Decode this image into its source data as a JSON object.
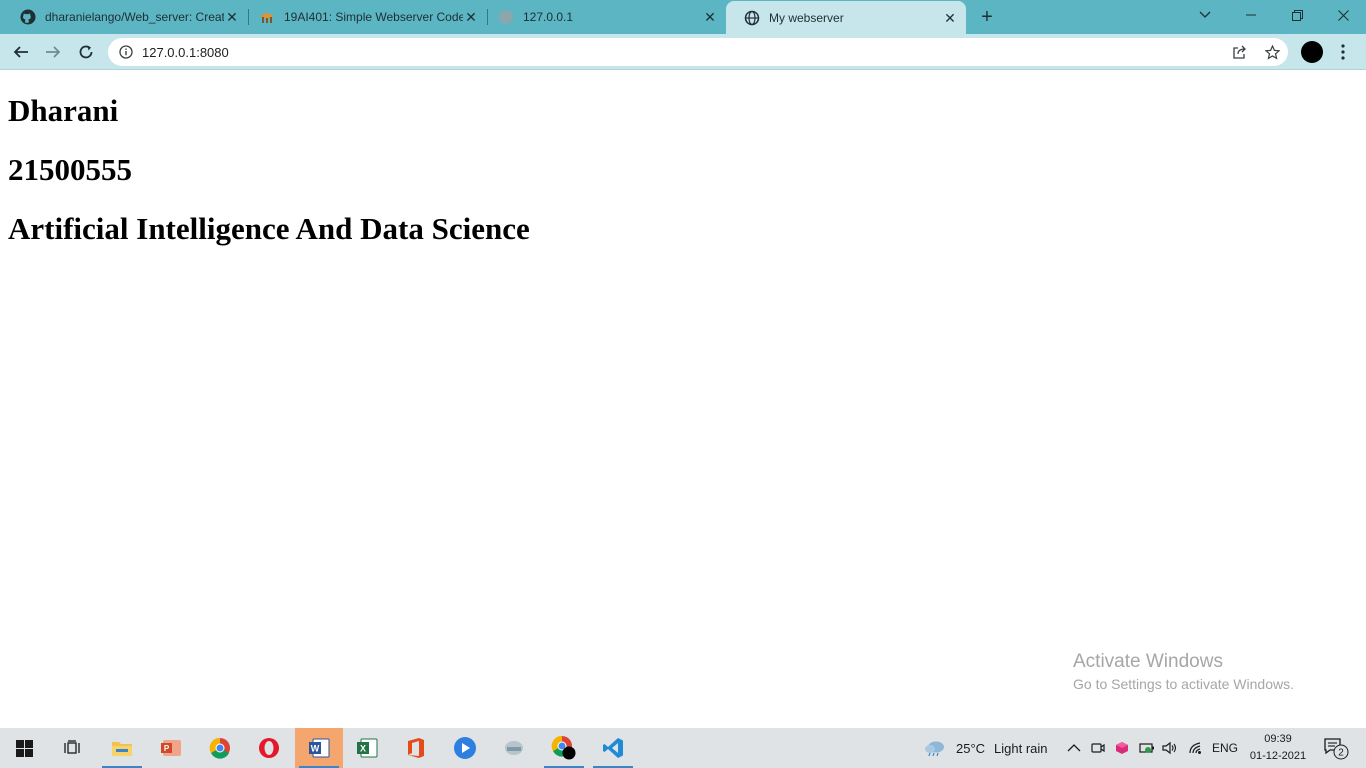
{
  "browser": {
    "tabs": [
      {
        "title": "dharanielango/Web_server: Creat",
        "favicon": "github-icon"
      },
      {
        "title": "19AI401: Simple Webserver Code",
        "favicon": "moodle-icon"
      },
      {
        "title": "127.0.0.1",
        "favicon": "globe-icon"
      },
      {
        "title": "My webserver",
        "favicon": "globe-icon",
        "active": true
      }
    ],
    "new_tab_label": "+",
    "url": "127.0.0.1:8080"
  },
  "page": {
    "lines": [
      "Dharani",
      "21500555",
      "Artificial Intelligence And Data Science"
    ]
  },
  "watermark": {
    "line1": "Activate Windows",
    "line2": "Go to Settings to activate Windows."
  },
  "taskbar": {
    "weather_temp": "25°C",
    "weather_desc": "Light rain",
    "language": "ENG",
    "time": "09:39",
    "date": "01-12-2021",
    "notification_count": "2"
  },
  "colors": {
    "tabbar": "#5bb5c2",
    "toolbar": "#c6e6eb",
    "taskbar": "#dfe3e6"
  }
}
